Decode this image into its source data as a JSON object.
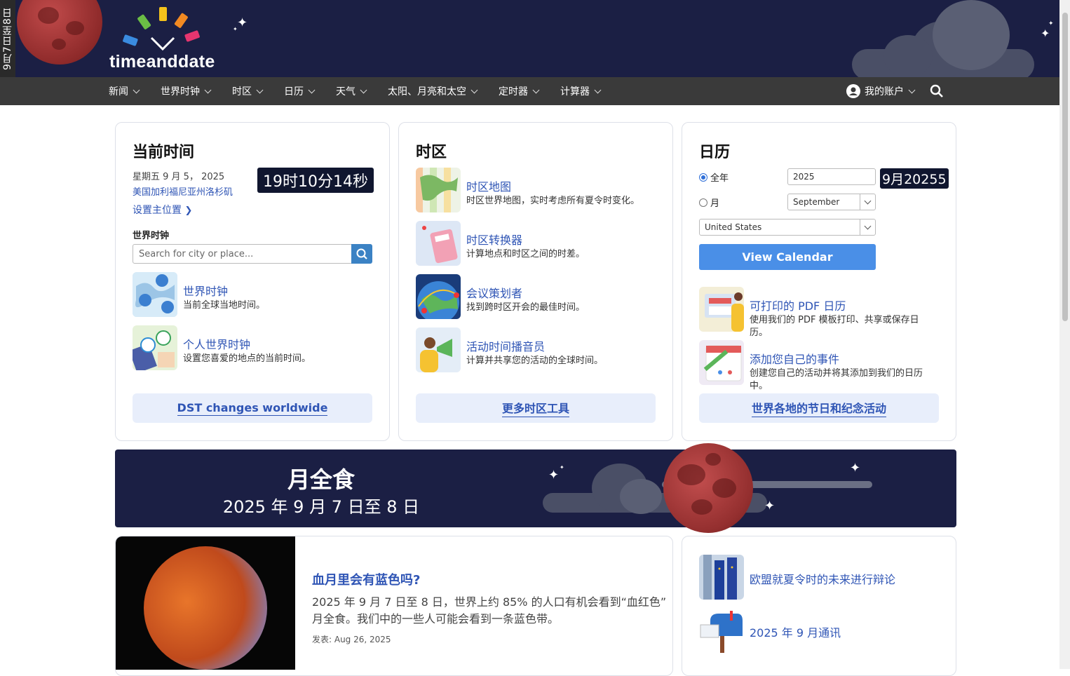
{
  "eclipse_side_label": "9月7日至8日",
  "logo": {
    "text": "timeanddate"
  },
  "nav": {
    "items": [
      "新闻",
      "世界时钟",
      "时区",
      "日历",
      "天气",
      "太阳、月亮和太空",
      "定时器",
      "计算器"
    ],
    "account": "我的账户"
  },
  "current_time": {
    "title": "当前时间",
    "date": "星期五 9 月 5， 2025",
    "location": "美国加利福尼亚州洛杉矶",
    "set_location": "设置主位置",
    "clock": "19时10分14秒",
    "world_clock_label": "世界时钟",
    "search_placeholder": "Search for city or place...",
    "tools": [
      {
        "title": "世界时钟",
        "desc": "当前全球当地时间。"
      },
      {
        "title": "个人世界时钟",
        "desc": "设置您喜爱的地点的当前时间。"
      }
    ],
    "button": "DST changes worldwide"
  },
  "time_zones": {
    "title": "时区",
    "tools": [
      {
        "title": "时区地图",
        "desc": "时区世界地图，实时考虑所有夏令时变化。"
      },
      {
        "title": "时区转换器",
        "desc": "计算地点和时区之间的时差。"
      },
      {
        "title": "会议策划者",
        "desc": "找到跨时区开会的最佳时间。"
      },
      {
        "title": "活动时间播音员",
        "desc": "计算并共享您的活动的全球时间。"
      }
    ],
    "button": "更多时区工具"
  },
  "calendar": {
    "title": "日历",
    "radio_year": "全年",
    "radio_month": "月",
    "year_value": "2025",
    "month_value": "September",
    "country_value": "United States",
    "overlay": "9月20255",
    "view_button": "View Calendar",
    "tools": [
      {
        "title": "可打印的 PDF 日历",
        "desc1": "使用我们的 PDF 模板打印、共享或保存日",
        "desc2": "历。"
      },
      {
        "title": "添加您自己的事件",
        "desc1": "创建您自己的活动并将其添加到我们的日历",
        "desc2": "中。"
      }
    ],
    "button": "世界各地的节日和纪念活动"
  },
  "banner": {
    "title": "月全食",
    "date": "2025 年 9 月 7 日至 8 日"
  },
  "article": {
    "title": "血月里会有蓝色吗?",
    "line1": "2025 年 9 月 7 日至 8 日，世界上约 85% 的人口有机会看到“血红色”",
    "line2": "月全食。我们中的一些人可能会看到一条蓝色带。",
    "published": "发表:  Aug 26, 2025"
  },
  "news": [
    {
      "title": "欧盟就夏令时的未来进行辩论"
    },
    {
      "title": "2025 年 9 月通讯"
    }
  ],
  "colors": {
    "header": "#1b1f44",
    "nav": "#3a3a3a",
    "link": "#2f55b5",
    "accent_button": "#4a8fe7"
  }
}
